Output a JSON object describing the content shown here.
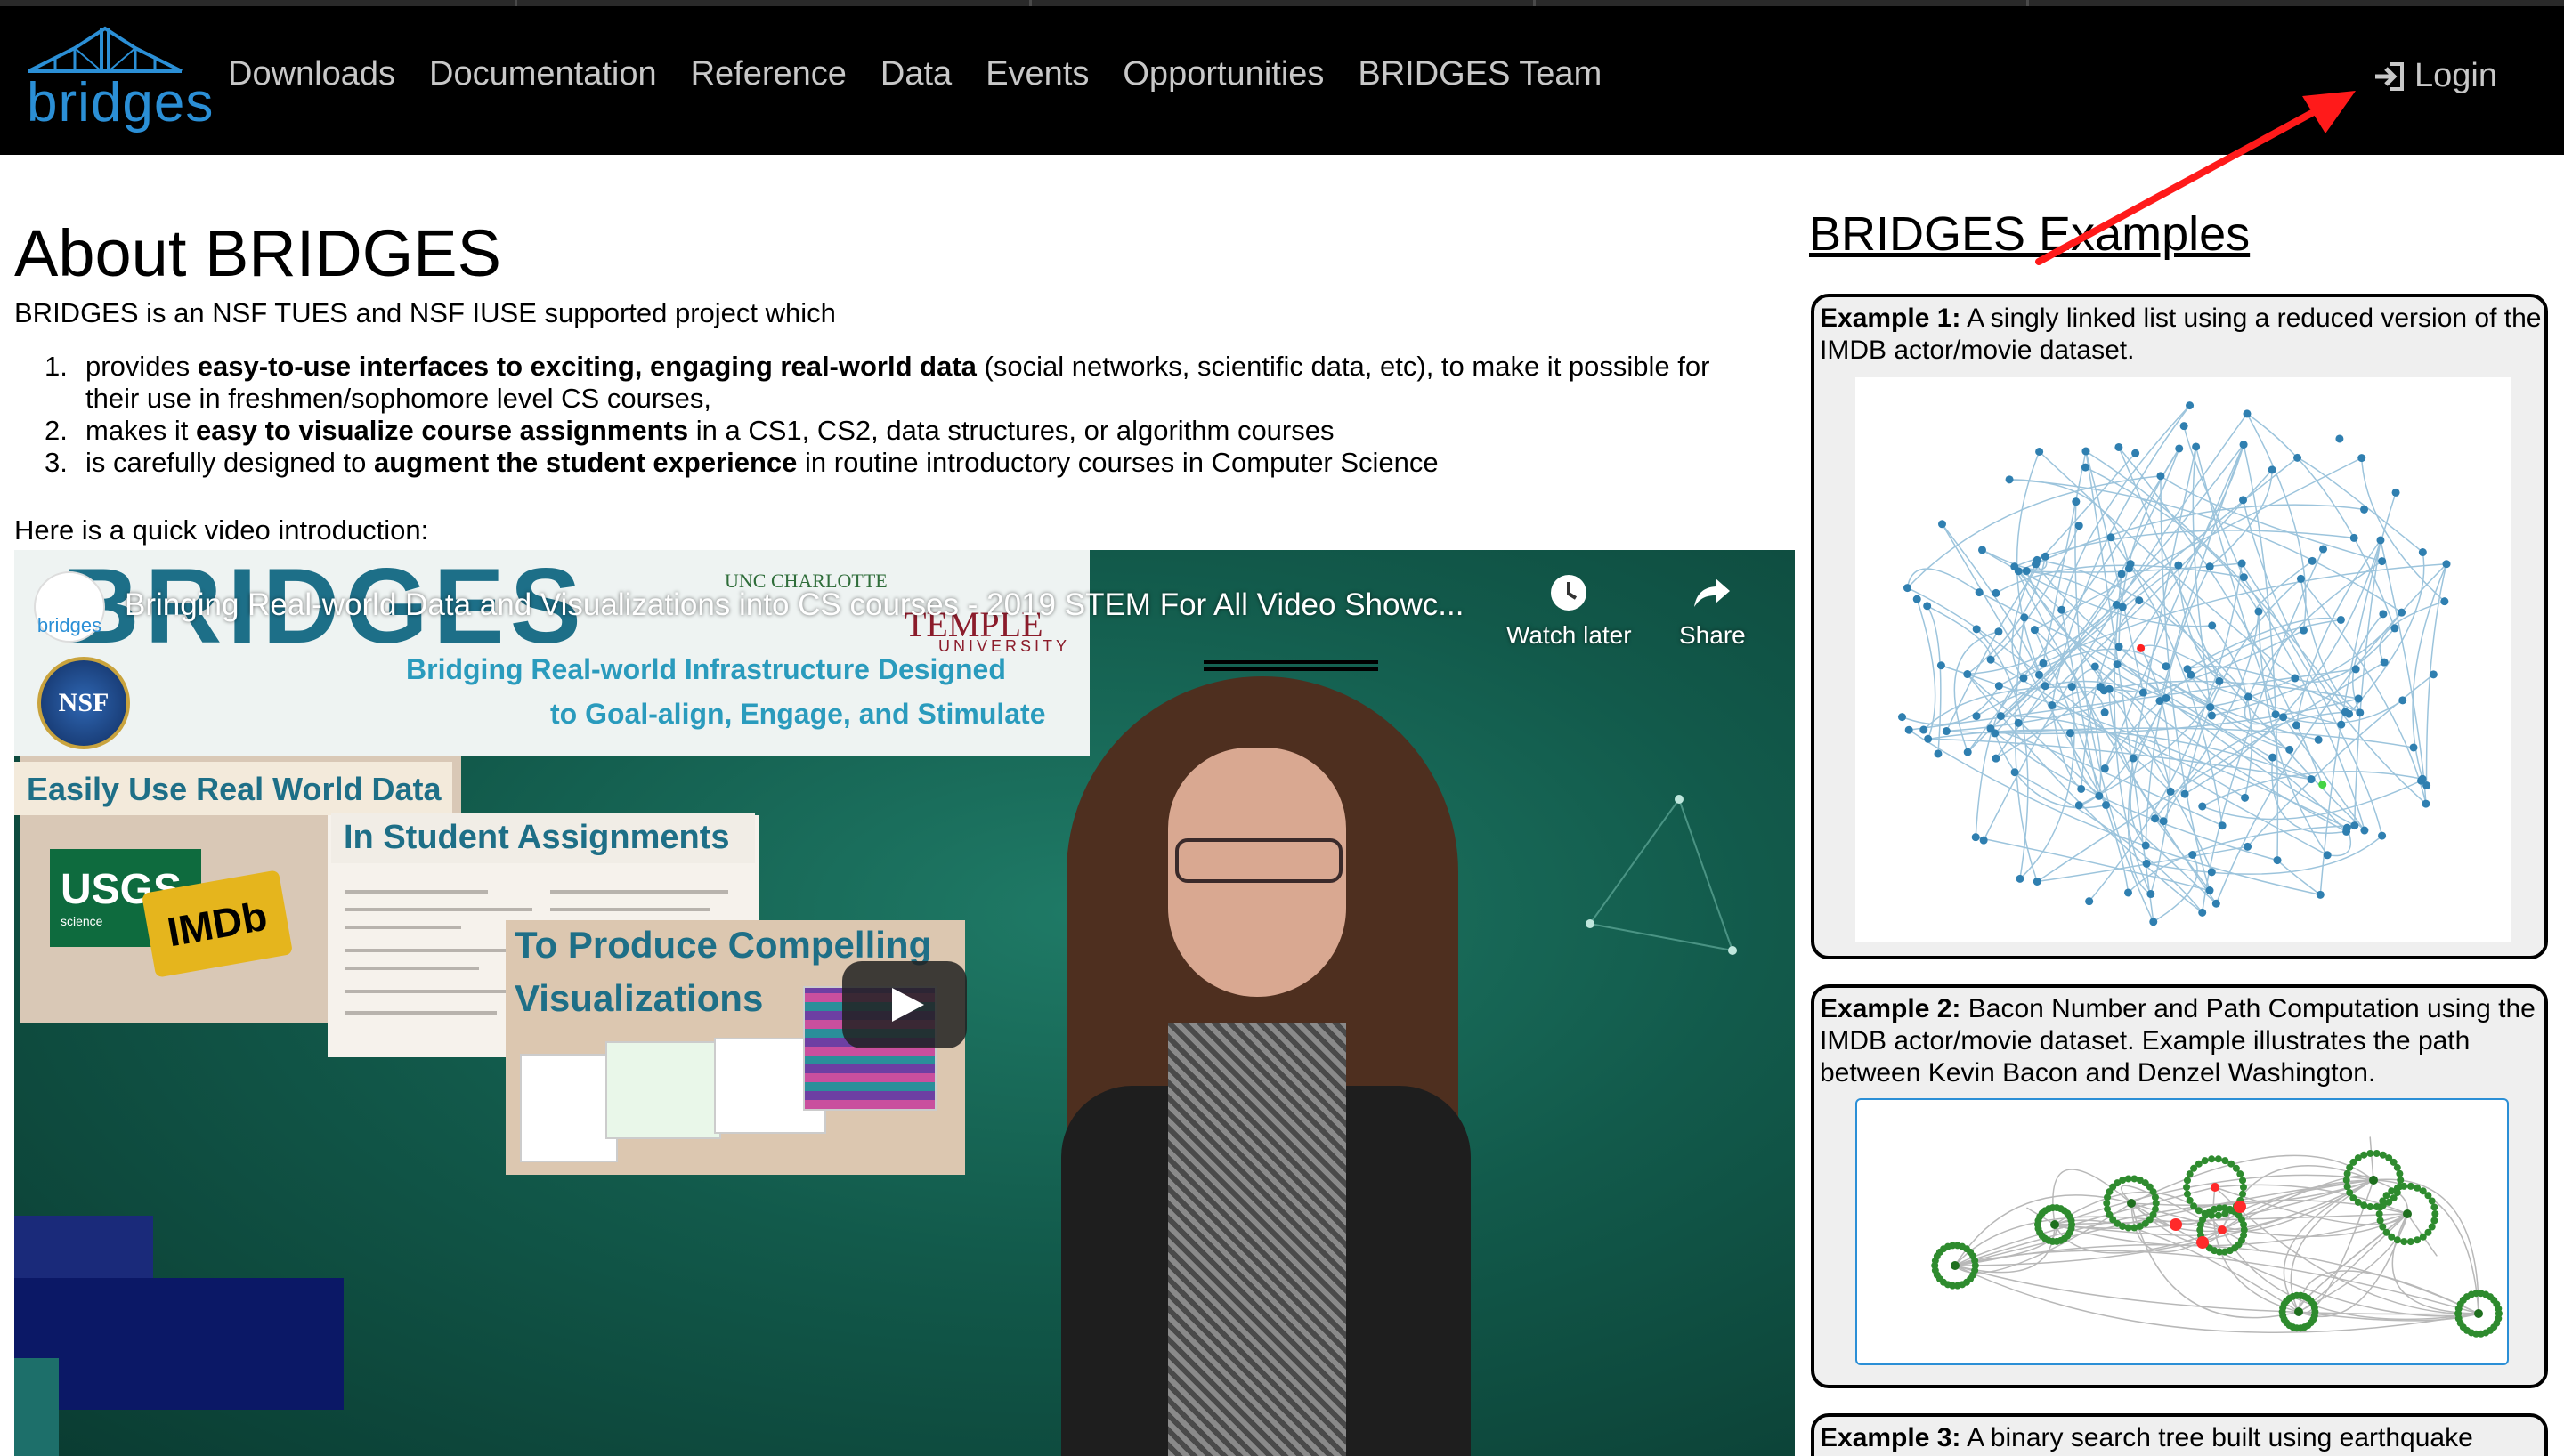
{
  "navbar": {
    "logo_text": "bridges",
    "links": [
      "Downloads",
      "Documentation",
      "Reference",
      "Data",
      "Events",
      "Opportunities",
      "BRIDGES Team"
    ],
    "login_label": "Login"
  },
  "main": {
    "title": "About BRIDGES",
    "intro": "BRIDGES is an NSF TUES and NSF IUSE supported project which",
    "features": [
      {
        "num": "1.",
        "pre": "provides ",
        "bold": "easy-to-use interfaces to exciting, engaging real-world data",
        "post": " (social networks, scientific data, etc), to make it possible for",
        "cont": "their use in freshmen/sophomore level CS courses,"
      },
      {
        "num": "2.",
        "pre": "makes it ",
        "bold": "easy to visualize course assignments",
        "post": " in a CS1, CS2, data structures, or algorithm courses"
      },
      {
        "num": "3.",
        "pre": "is carefully designed to ",
        "bold": "augment the student experience",
        "post": " in routine introductory courses in Computer Science"
      }
    ],
    "video_intro": "Here is a quick video introduction:"
  },
  "video": {
    "title": "Bringing Real-world Data and Visualizations into CS courses - 2019 STEM For All Video Showc...",
    "channel_avatar_text": "bridges",
    "watch_later_label": "Watch later",
    "share_label": "Share",
    "banner_text": "BRIDGES",
    "unc_text": "UNC CHARLOTTE",
    "temple_text": "TEMPLE",
    "temple_sub": "UNIVERSITY",
    "nsf_text": "NSF",
    "tagline_1": "Bridging Real-world Infrastructure Designed",
    "tagline_2": "to Goal-align, Engage, and Stimulate",
    "card_1": "Easily Use Real World Data",
    "card_2": "In Student Assignments",
    "card_3_line1": "To Produce Compelling",
    "card_3_line2": "Visualizations",
    "usgs_text": "USGS",
    "usgs_sub": "science",
    "imdb_text": "IMDb"
  },
  "sidebar": {
    "title": "BRIDGES Examples",
    "examples": [
      {
        "label": "Example 1:",
        "text": " A singly linked list using a reduced version of the IMDB actor/movie dataset."
      },
      {
        "label": "Example 2:",
        "text": " Bacon Number and Path Computation using the IMDB actor/movie dataset. Example illustrates the path between Kevin Bacon and Denzel Washington."
      },
      {
        "label": "Example 3:",
        "text": " A binary search tree built using earthquake"
      }
    ]
  },
  "colors": {
    "navbar_bg": "#000000",
    "nav_text": "#c8c8c8",
    "logo_blue": "#2b8fd6",
    "node_blue": "#2f7fb0",
    "node_green": "#2e8b2e",
    "annotation_red": "#ff1a1a"
  },
  "icons": [
    "bridge-logo-icon",
    "login-icon",
    "clock-icon",
    "share-icon",
    "play-icon"
  ]
}
